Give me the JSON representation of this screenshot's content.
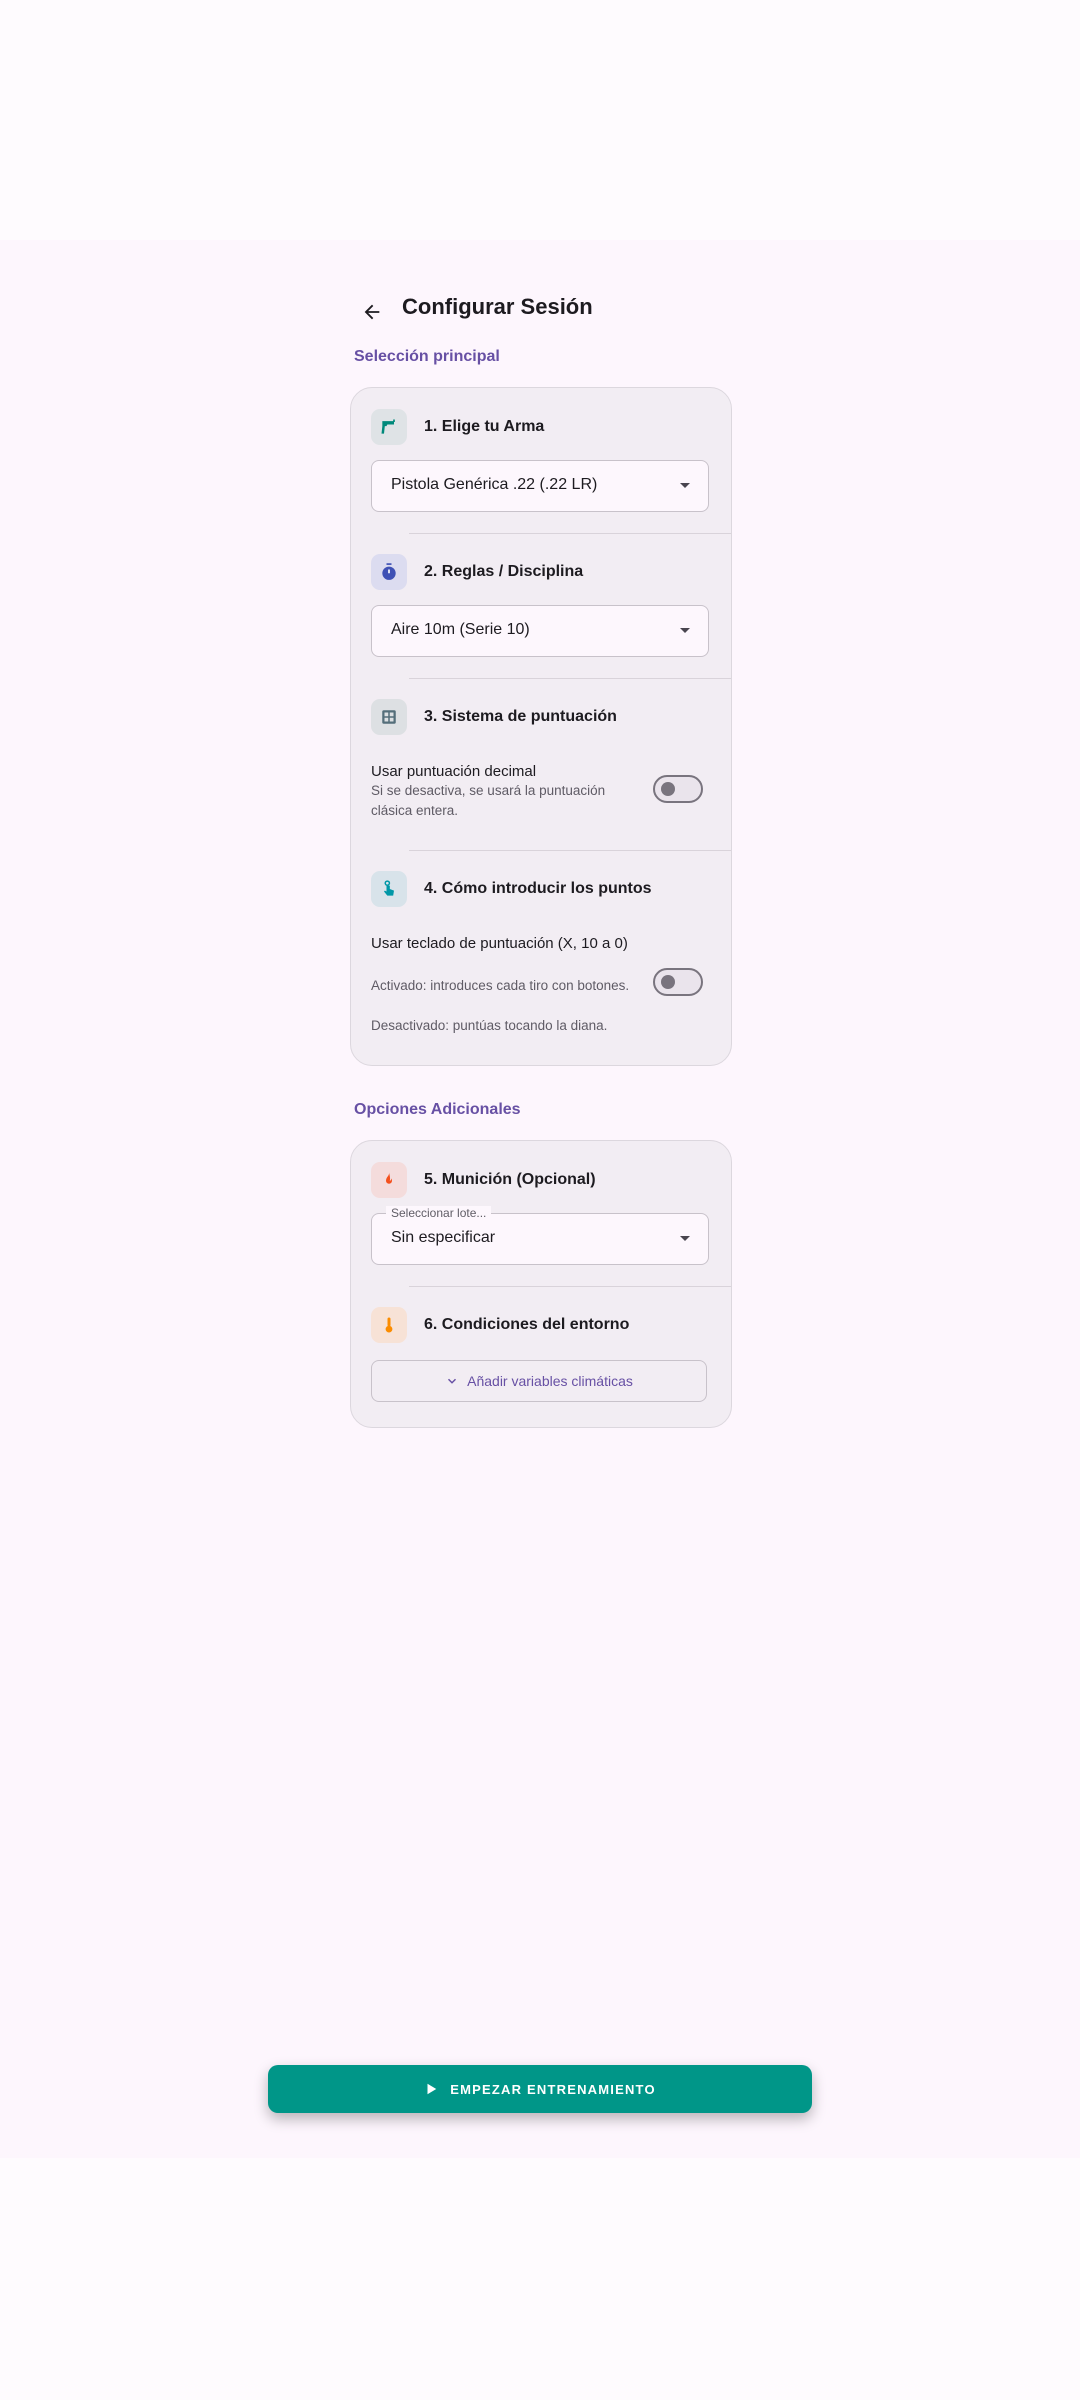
{
  "header": {
    "title": "Configurar Sesión",
    "back_icon": "arrow-back-icon"
  },
  "sections": {
    "main_label": "Selección principal",
    "extra_label": "Opciones Adicionales"
  },
  "weapon": {
    "title": "1. Elige tu Arma",
    "icon": "pistol-icon",
    "selected": "Pistola Genérica .22 (.22 LR)"
  },
  "rules": {
    "title": "2. Reglas / Disciplina",
    "icon": "timer-icon",
    "selected": "Aire 10m (Serie 10)"
  },
  "scoring": {
    "title": "3. Sistema de puntuación",
    "icon": "calculator-icon",
    "option_title": "Usar puntuación decimal",
    "option_subtitle": "Si se desactiva, se usará la puntuación clásica entera.",
    "enabled": false
  },
  "input_mode": {
    "title": "4. Cómo introducir los puntos",
    "icon": "touch-icon",
    "option_title": "Usar teclado de puntuación (X, 10 a 0)",
    "option_subtitle_1": "Activado: introduces cada tiro con botones.",
    "option_subtitle_2": "Desactivado: puntúas tocando la diana.",
    "enabled": false
  },
  "ammo": {
    "title": "5. Munición (Opcional)",
    "icon": "fire-icon",
    "label": "Seleccionar lote...",
    "selected": "Sin especificar"
  },
  "environment": {
    "title": "6. Condiciones del entorno",
    "icon": "thermometer-icon",
    "button_label": "Añadir variables climáticas"
  },
  "start_button": {
    "label": "EMPEZAR ENTRENAMIENTO",
    "icon": "play-icon"
  },
  "colors": {
    "primary": "#6750a4",
    "accent": "#009688",
    "background": "#fdf6fd"
  }
}
